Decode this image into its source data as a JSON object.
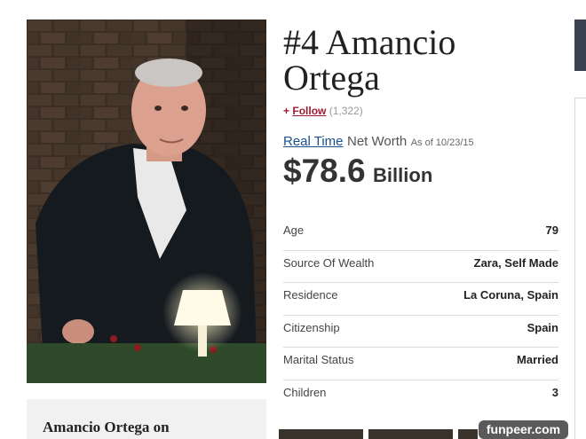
{
  "profile": {
    "rank": "#4",
    "name": "Amancio Ortega",
    "follow_plus": "+",
    "follow_label": "Follow",
    "follow_count": "(1,322)",
    "realtime_label": "Real Time",
    "networth_label": "Net Worth",
    "as_of": "As of 10/23/15",
    "net_worth_amount": "$78.6",
    "net_worth_unit": "Billion"
  },
  "stats": [
    {
      "label": "Age",
      "value": "79"
    },
    {
      "label": "Source Of Wealth",
      "value": "Zara, Self Made"
    },
    {
      "label": "Residence",
      "value": "La Coruna, Spain"
    },
    {
      "label": "Citizenship",
      "value": "Spain"
    },
    {
      "label": "Marital Status",
      "value": "Married"
    },
    {
      "label": "Children",
      "value": "3"
    }
  ],
  "related": {
    "title": "Amancio Ortega on"
  },
  "watermark": "funpeer.com"
}
